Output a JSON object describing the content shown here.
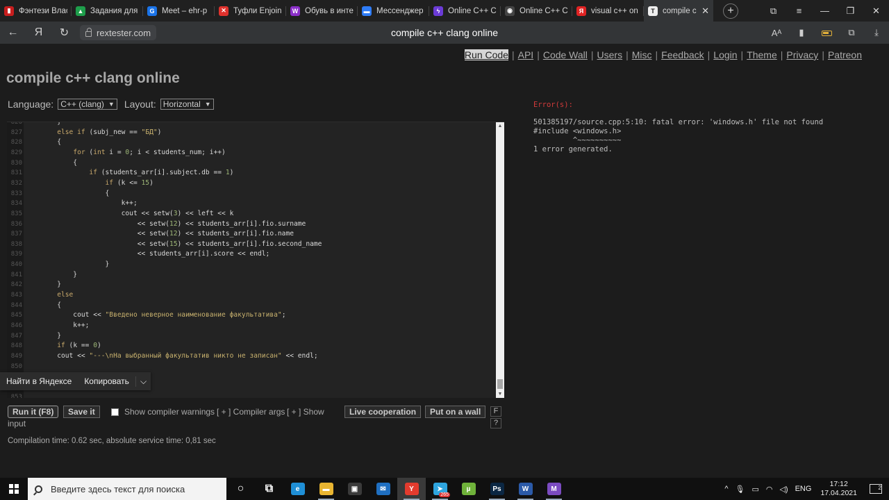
{
  "browser": {
    "tabs": [
      {
        "label": "Фэнтези Влас",
        "color": "#c81e1e",
        "glyph": "▮"
      },
      {
        "label": "Задания для",
        "color": "#1e9e4b",
        "glyph": "▲"
      },
      {
        "label": "Meet – ehr-p",
        "color": "#1a73e8",
        "glyph": "G"
      },
      {
        "label": "Туфли Enjoin",
        "color": "#e0322d",
        "glyph": "✕"
      },
      {
        "label": "Обувь в инте",
        "color": "#8b2fc9",
        "glyph": "W"
      },
      {
        "label": "Мессенджер",
        "color": "#2e7cf6",
        "glyph": "▬"
      },
      {
        "label": "Online C++ C",
        "color": "#6b3bd6",
        "glyph": "ϟ"
      },
      {
        "label": "Online C++ C",
        "color": "#444444",
        "glyph": "◉"
      },
      {
        "label": "visual c++ on",
        "color": "#e02323",
        "glyph": "Я"
      }
    ],
    "active_tab": {
      "label": "compile c",
      "glyph": "T",
      "close": "✕"
    },
    "new_tab": "+",
    "window_controls": [
      "⧉",
      "≡",
      "—",
      "❐",
      "✕"
    ],
    "url": "rextester.com",
    "page_title": "compile c++ clang online",
    "nav": {
      "back": "←",
      "yandex": "Я",
      "reload": "↻"
    },
    "right_icons": [
      "Aᴬ",
      "▮",
      "battery",
      "⧉",
      "⤓"
    ]
  },
  "page": {
    "topnav": [
      "Run Code",
      "API",
      "Code Wall",
      "Users",
      "Misc",
      "Feedback",
      "Login",
      "Theme",
      "Privacy",
      "Patreon"
    ],
    "heading": "compile c++ clang online",
    "language_label": "Language:",
    "language_value": "C++ (clang)",
    "layout_label": "Layout:",
    "layout_value": "Horizontal",
    "code_lines": [
      {
        "n": "826",
        "t": "        }"
      },
      {
        "n": "827",
        "t": "        else if (subj_new == \"БД\")"
      },
      {
        "n": "828",
        "t": "        {"
      },
      {
        "n": "829",
        "t": "            for (int i = 0; i < students_num; i++)"
      },
      {
        "n": "830",
        "t": "            {"
      },
      {
        "n": "831",
        "t": "                if (students_arr[i].subject.db == 1)"
      },
      {
        "n": "832",
        "t": "                    if (k <= 15)"
      },
      {
        "n": "833",
        "t": "                    {"
      },
      {
        "n": "834",
        "t": "                        k++;"
      },
      {
        "n": "835",
        "t": "                        cout << setw(3) << left << k"
      },
      {
        "n": "836",
        "t": "                            << setw(12) << students_arr[i].fio.surname"
      },
      {
        "n": "837",
        "t": "                            << setw(12) << students_arr[i].fio.name"
      },
      {
        "n": "838",
        "t": "                            << setw(15) << students_arr[i].fio.second_name"
      },
      {
        "n": "839",
        "t": "                            << students_arr[i].score << endl;"
      },
      {
        "n": "840",
        "t": "                    }"
      },
      {
        "n": "841",
        "t": "            }"
      },
      {
        "n": "842",
        "t": "        }"
      },
      {
        "n": "843",
        "t": "        else"
      },
      {
        "n": "844",
        "t": "        {"
      },
      {
        "n": "845",
        "t": "            cout << \"Введено неверное наименование факультатива\";"
      },
      {
        "n": "846",
        "t": "            k++;"
      },
      {
        "n": "847",
        "t": "        }"
      },
      {
        "n": "848",
        "t": "        if (k == 0)"
      },
      {
        "n": "849",
        "t": "        cout << \"---\\nНа выбранный факультатив никто не записан\" << endl;"
      },
      {
        "n": "850",
        "t": ""
      },
      {
        "n": "851",
        "t": ""
      },
      {
        "n": "852",
        "t": ""
      },
      {
        "n": "853",
        "t": ""
      }
    ],
    "context_popup": {
      "find": "Найти в Яндексе",
      "copy": "Копировать",
      "more": "⌵"
    },
    "actions": {
      "run": "Run it (F8)",
      "save": "Save it",
      "show_warnings": "Show compiler warnings",
      "compiler_args": "[ + ] Compiler args",
      "show": "[ + ] Show",
      "input": "input",
      "live": "Live cooperation",
      "wall": "Put on a wall",
      "f": "F",
      "q": "?"
    },
    "compilation_time": "Compilation time: 0.62 sec, absolute service time: 0,81 sec",
    "output": {
      "error_title": "Error(s):",
      "lines": [
        "501385197/source.cpp:5:10: fatal error: 'windows.h' file not found",
        "#include <windows.h>",
        "         ^~~~~~~~~~~",
        "1 error generated."
      ]
    }
  },
  "taskbar": {
    "search_placeholder": "Введите здесь текст для поиска",
    "apps": [
      {
        "name": "cortana",
        "glyph": "○",
        "color": "transparent"
      },
      {
        "name": "task-view",
        "glyph": "⧉",
        "color": "transparent"
      },
      {
        "name": "edge",
        "glyph": "e",
        "color": "#1f8fd6"
      },
      {
        "name": "explorer",
        "glyph": "▬",
        "color": "#e8b531"
      },
      {
        "name": "store",
        "glyph": "▣",
        "color": "#3a3a3a"
      },
      {
        "name": "mail",
        "glyph": "✉",
        "color": "#1f6fc1"
      },
      {
        "name": "yandex",
        "glyph": "Y",
        "color": "#e33b2e"
      },
      {
        "name": "telegram",
        "glyph": "➤",
        "color": "#2ea4de"
      },
      {
        "name": "utorrent",
        "glyph": "µ",
        "color": "#6fb23a"
      },
      {
        "name": "photoshop",
        "glyph": "Ps",
        "color": "#0b2743"
      },
      {
        "name": "word",
        "glyph": "W",
        "color": "#2b5aa8"
      },
      {
        "name": "visual-studio",
        "glyph": "M",
        "color": "#7b4bc0"
      }
    ],
    "telegram_badge": "265",
    "tray": {
      "chevron": "^",
      "mic": "🎙",
      "battery": "▭",
      "wifi": "◠",
      "volume": "◁)",
      "lang": "ENG"
    },
    "time": "17:12",
    "date": "17.04.2021",
    "notifications": "2"
  }
}
